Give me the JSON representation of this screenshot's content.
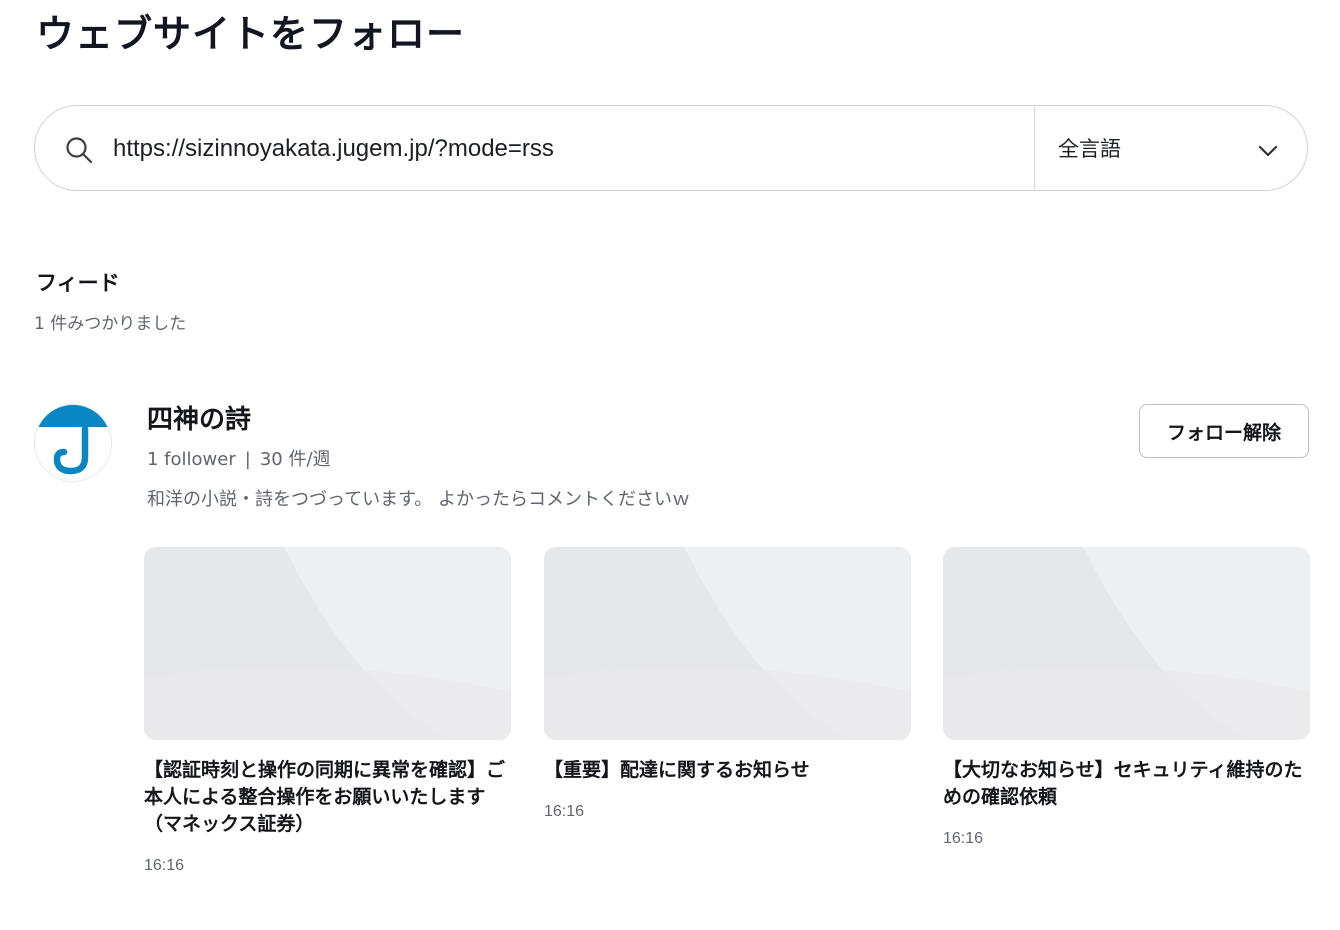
{
  "page": {
    "title": "ウェブサイトをフォロー"
  },
  "search": {
    "value": "https://sizinnoyakata.jugem.jp/?mode=rss",
    "language": "全言語"
  },
  "results": {
    "section_title": "フィード",
    "count_text": "1 件みつかりました"
  },
  "feed": {
    "name": "四神の詩",
    "followers": "1 follower",
    "separator": "|",
    "frequency": "30 件/週",
    "description": "和洋の小説・詩をつづっています。 よかったらコメントくださいｗ",
    "unfollow_label": "フォロー解除",
    "accent_color": "#0a86c4",
    "articles": [
      {
        "title": "【認証時刻と操作の同期に異常を確認】ご本人による整合操作をお願いいたします（マネックス証券）",
        "time": "16:16"
      },
      {
        "title": "【重要】配達に関するお知らせ",
        "time": "16:16"
      },
      {
        "title": "【大切なお知らせ】セキュリティ維持のための確認依頼",
        "time": "16:16"
      }
    ]
  }
}
